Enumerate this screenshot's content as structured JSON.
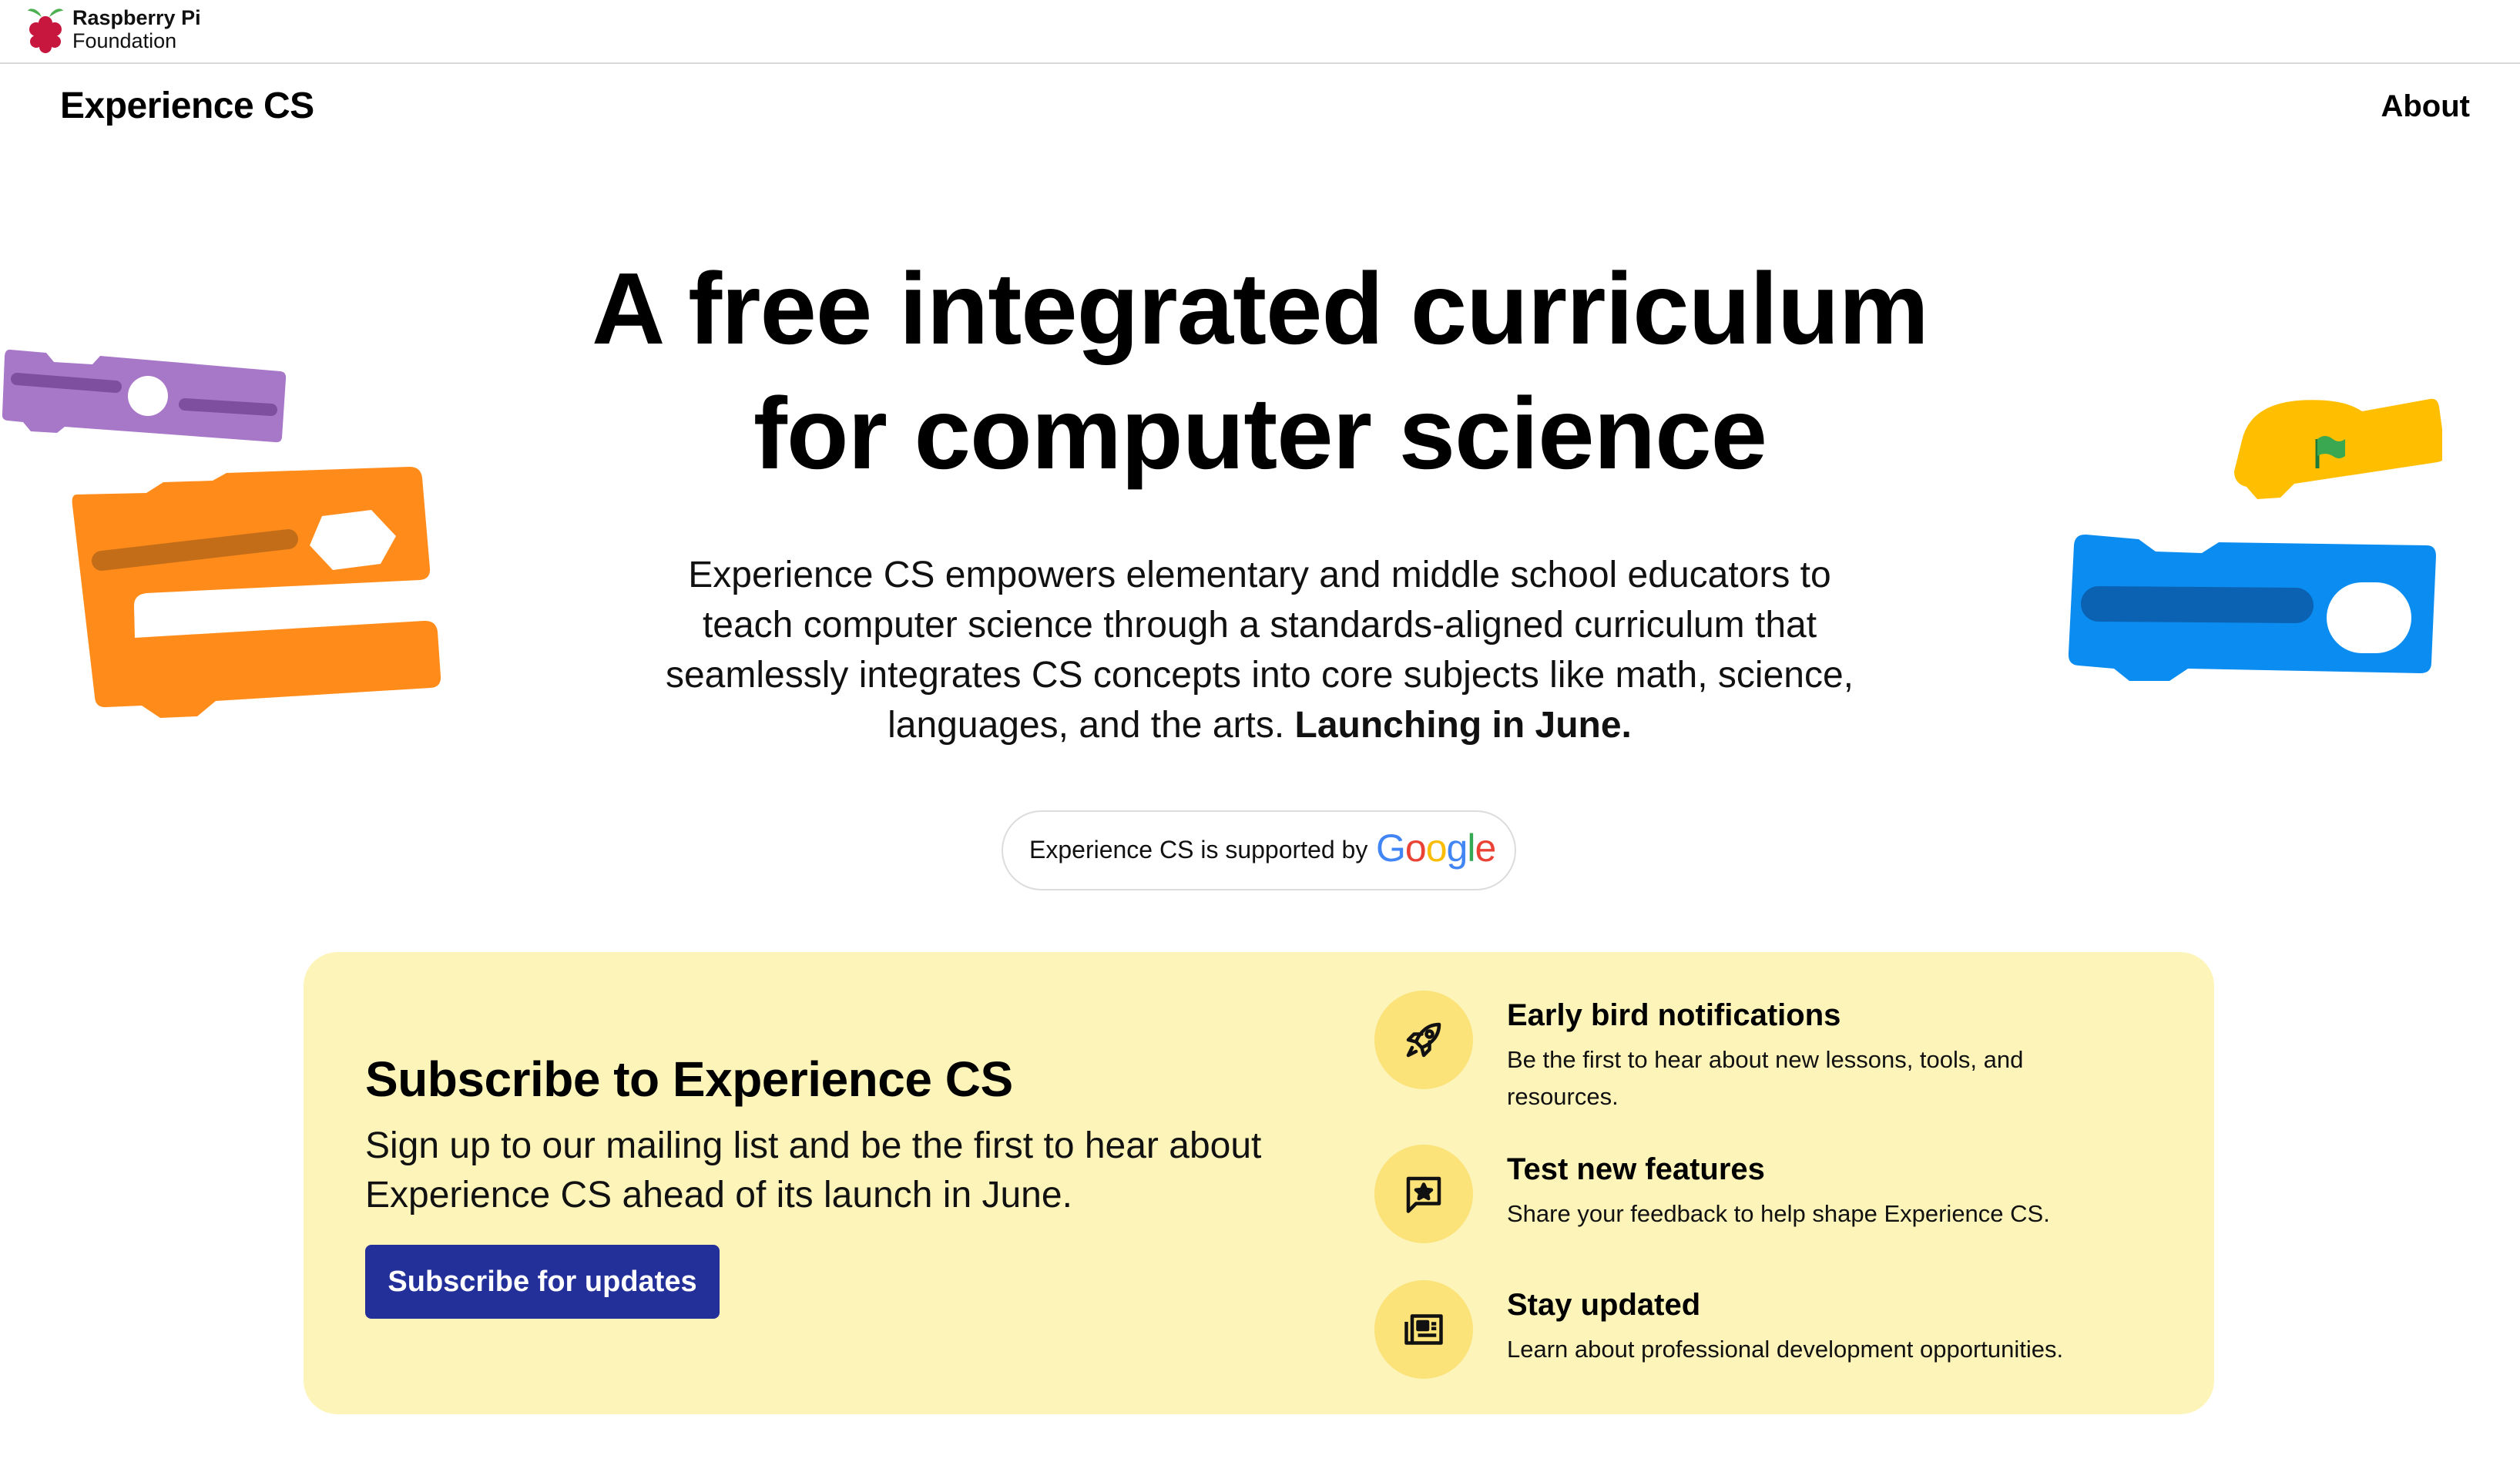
{
  "org": {
    "line1": "Raspberry Pi",
    "line2": "Foundation"
  },
  "header": {
    "site_title": "Experience CS",
    "nav_about": "About"
  },
  "hero": {
    "title": "A free integrated curriculum for computer science",
    "description": "Experience CS empowers elementary and middle school educators to teach computer science through a standards-aligned curriculum that seamlessly integrates CS concepts into core subjects like math, science, languages, and the arts.",
    "description_bold": "Launching in June."
  },
  "support": {
    "text": "Experience CS is supported by",
    "brand": "Google"
  },
  "subscribe": {
    "title": "Subscribe to Experience CS",
    "description": "Sign up to our mailing list and be the first to hear about Experience CS ahead of its launch in June.",
    "button_label": "Subscribe for updates"
  },
  "features": [
    {
      "icon": "rocket-icon",
      "title": "Early bird notifications",
      "description": "Be the first to hear about new lessons, tools, and resources."
    },
    {
      "icon": "star-feedback-icon",
      "title": "Test new features",
      "description": "Share your feedback to help shape Experience CS."
    },
    {
      "icon": "newspaper-icon",
      "title": "Stay updated",
      "description": "Learn about professional development opportunities."
    }
  ],
  "colors": {
    "accent_button": "#24309a",
    "card_background": "#fdf4b9",
    "icon_circle": "#fbe279",
    "block_purple": "#a878c8",
    "block_orange": "#ff8c1a",
    "block_yellow": "#ffbf00",
    "block_blue": "#0a8cf0"
  }
}
